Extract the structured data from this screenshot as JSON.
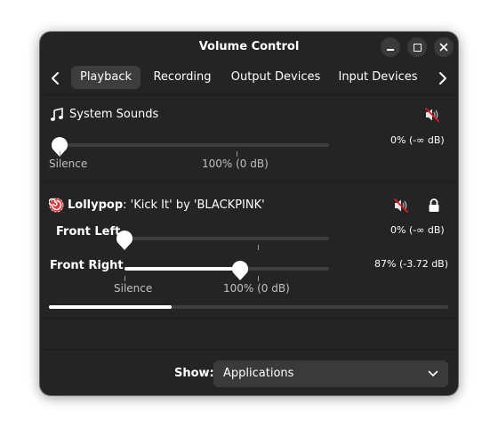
{
  "window": {
    "title": "Volume Control"
  },
  "tabs": [
    {
      "label": "Playback",
      "active": true
    },
    {
      "label": "Recording",
      "active": false
    },
    {
      "label": "Output Devices",
      "active": false
    },
    {
      "label": "Input Devices",
      "active": false
    }
  ],
  "system_sounds": {
    "name": "System Sounds",
    "level": 0,
    "readout": "0% (-∞ dB)",
    "mark_silence": "Silence",
    "mark_100": "100% (0 dB)",
    "muted": true
  },
  "stream": {
    "app_name": "Lollypop",
    "media_title": ": 'Kick It' by 'BLACKPINK'",
    "muted": true,
    "locked": true,
    "channels": [
      {
        "label": "Front Left",
        "level": 0,
        "readout": "0% (-∞ dB)"
      },
      {
        "label": "Front Right",
        "level": 0.87,
        "readout": "87% (-3.72 dB)"
      }
    ],
    "mark_silence": "Silence",
    "mark_100": "100% (0 dB)",
    "peak_level": 0.3
  },
  "footer": {
    "show_label": "Show:",
    "selected": "Applications"
  },
  "colors": {
    "window_bg": "#242424",
    "accent": "#ffffff",
    "mute_red": "#e01b24"
  }
}
